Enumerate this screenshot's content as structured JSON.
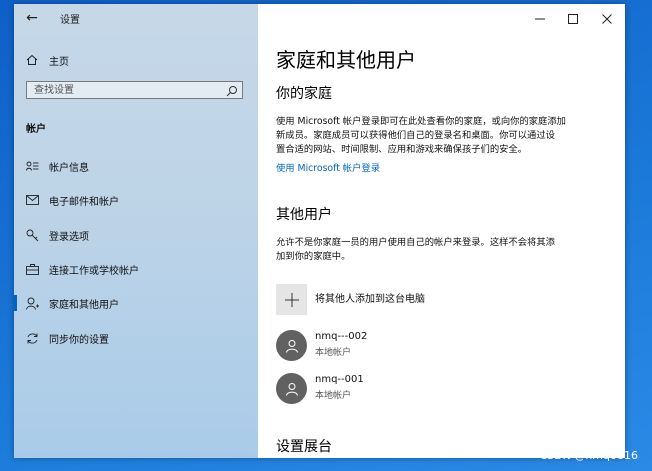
{
  "window": {
    "title": "设置",
    "back_icon": "←",
    "controls": {
      "minimize": "minimize-icon",
      "maximize": "maximize-icon",
      "close": "close-icon"
    }
  },
  "sidebar": {
    "home_label": "主页",
    "search": {
      "placeholder": "查找设置",
      "value": ""
    },
    "section_title": "帐户",
    "items": [
      {
        "label": "帐户信息",
        "icon": "account-info-icon",
        "active": false
      },
      {
        "label": "电子邮件和帐户",
        "icon": "mail-icon",
        "active": false
      },
      {
        "label": "登录选项",
        "icon": "key-icon",
        "active": false
      },
      {
        "label": "连接工作或学校帐户",
        "icon": "briefcase-icon",
        "active": false
      },
      {
        "label": "家庭和其他用户",
        "icon": "person-icon",
        "active": true
      },
      {
        "label": "同步你的设置",
        "icon": "sync-icon",
        "active": false
      }
    ]
  },
  "content": {
    "title": "家庭和其他用户",
    "family": {
      "heading": "你的家庭",
      "line1": "使用 Microsoft 帐户登录即可在此处查看你的家庭，或向你的家庭添加",
      "line2": "新成员。家庭成员可以获得他们自己的登录名和桌面。你可以通过设",
      "line3": "置合适的网站、时间限制、应用和游戏来确保孩子们的安全。",
      "link": "使用 Microsoft 帐户登录"
    },
    "others": {
      "heading": "其他用户",
      "line1": "允许不是你家庭一员的用户使用自己的帐户来登录。这样不会将其添",
      "line2": "加到你的家庭中。",
      "add_label": "将其他人添加到这台电脑",
      "users": [
        {
          "name": "nmq---002",
          "type": "本地帐户"
        },
        {
          "name": "nmq--001",
          "type": "本地帐户"
        }
      ]
    },
    "kiosk_heading": "设置展台"
  },
  "watermark": "CSDN @nmq0816",
  "colors": {
    "accent": "#0067c0",
    "avatar": "#616161",
    "sidebar": "#bcd3e7"
  }
}
